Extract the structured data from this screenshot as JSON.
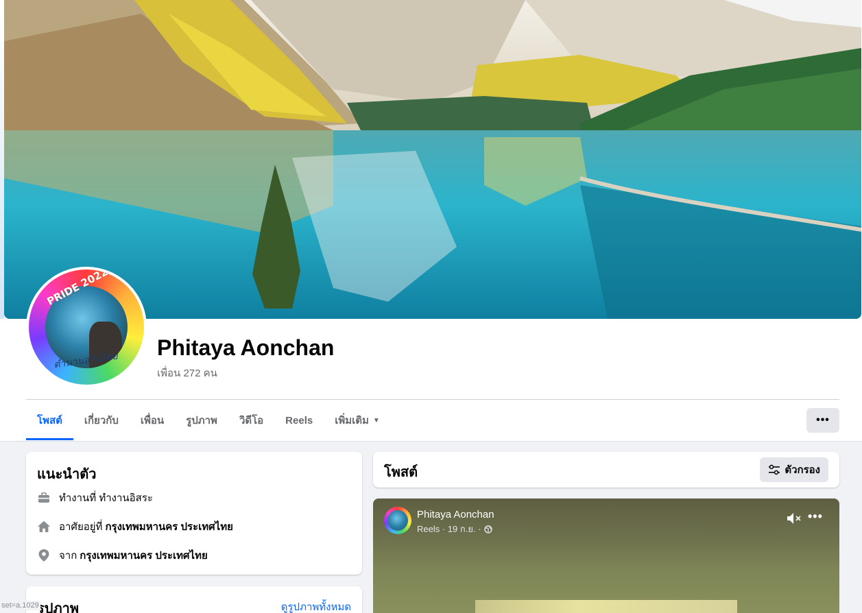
{
  "profile": {
    "name": "Phitaya Aonchan",
    "friends": "เพื่อน 272 คน",
    "avatar_text_top": "PRIDE 2022",
    "avatar_text_bottom": "ตำนานอธิปไตย"
  },
  "tabs": [
    {
      "label": "โพสต์",
      "active": true
    },
    {
      "label": "เกี่ยวกับ",
      "active": false
    },
    {
      "label": "เพื่อน",
      "active": false
    },
    {
      "label": "รูปภาพ",
      "active": false
    },
    {
      "label": "วิดีโอ",
      "active": false
    },
    {
      "label": "Reels",
      "active": false
    },
    {
      "label": "เพิ่มเติม",
      "active": false
    }
  ],
  "more_button_label": "•••",
  "intro": {
    "title": "แนะนำตัว",
    "work_prefix": "ทำงานที่ ทำงานอิสระ",
    "lives_prefix": "อาศัยอยู่ที่",
    "lives_value": "กรุงเทพมหานคร ประเทศไทย",
    "from_prefix": "จาก",
    "from_value": "กรุงเทพมหานคร ประเทศไทย"
  },
  "photos": {
    "title": "รูปภาพ",
    "see_all": "ดูรูปภาพทั้งหมด"
  },
  "status_url": "set=a.1029",
  "posts": {
    "title": "โพสต์",
    "filter_label": "ตัวกรอง"
  },
  "reel": {
    "author": "Phitaya Aonchan",
    "meta": "Reels · 19 ก.ย. ·",
    "more": "•••"
  },
  "colors": {
    "accent": "#0866ff",
    "page_bg": "#f0f2f5",
    "secondary_text": "#65676b",
    "button_bg": "#e4e6eb"
  },
  "icons": {
    "work": "briefcase-icon",
    "home": "home-icon",
    "location": "location-pin-icon",
    "filter": "filter-sliders-icon",
    "mute": "speaker-muted-icon",
    "globe": "globe-icon",
    "dropdown": "caret-down-icon"
  }
}
